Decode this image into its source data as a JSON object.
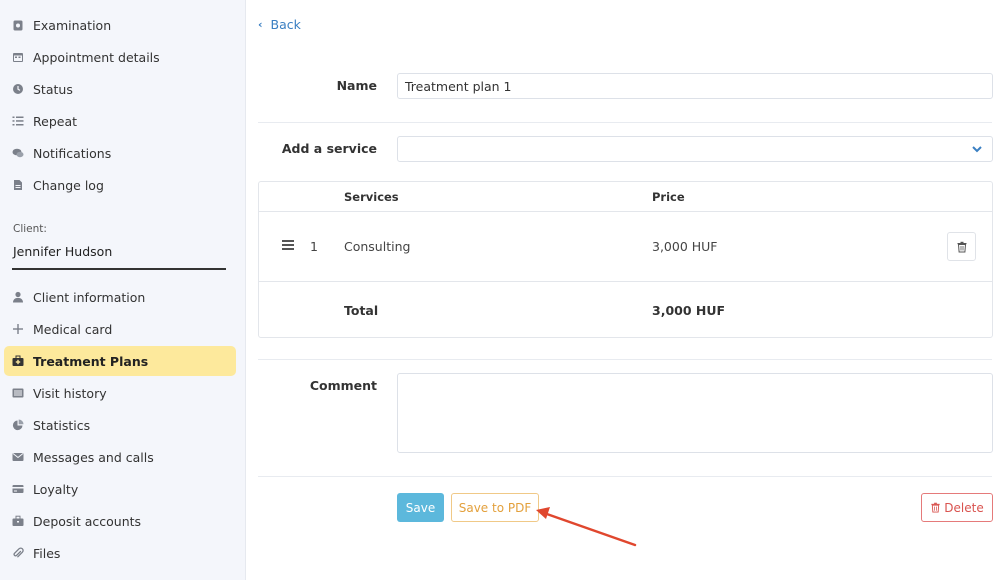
{
  "sidebar": {
    "items_top": [
      {
        "label": "Examination",
        "icon": "stethoscope-icon"
      },
      {
        "label": "Appointment details",
        "icon": "calendar-icon"
      },
      {
        "label": "Status",
        "icon": "clock-icon"
      },
      {
        "label": "Repeat",
        "icon": "list-icon"
      },
      {
        "label": "Notifications",
        "icon": "chat-icon"
      },
      {
        "label": "Change log",
        "icon": "document-icon"
      }
    ],
    "client_label": "Client:",
    "client_name": "Jennifer Hudson",
    "items_bottom": [
      {
        "label": "Client information",
        "icon": "user-icon"
      },
      {
        "label": "Medical card",
        "icon": "plus-icon"
      },
      {
        "label": "Treatment Plans",
        "icon": "medkit-icon",
        "active": true
      },
      {
        "label": "Visit history",
        "icon": "history-list-icon"
      },
      {
        "label": "Statistics",
        "icon": "pie-chart-icon"
      },
      {
        "label": "Messages and calls",
        "icon": "envelope-icon"
      },
      {
        "label": "Loyalty",
        "icon": "credit-card-icon"
      },
      {
        "label": "Deposit accounts",
        "icon": "briefcase-icon"
      },
      {
        "label": "Files",
        "icon": "paperclip-icon"
      }
    ]
  },
  "main": {
    "back_label": "Back",
    "name_label": "Name",
    "name_value": "Treatment plan 1",
    "add_service_label": "Add a service",
    "add_service_value": "",
    "table": {
      "headers": {
        "services": "Services",
        "price": "Price"
      },
      "rows": [
        {
          "index": "1",
          "service": "Consulting",
          "price": "3,000 HUF"
        }
      ],
      "total_label": "Total",
      "total_value": "3,000 HUF"
    },
    "comment_label": "Comment",
    "comment_value": "",
    "buttons": {
      "save": "Save",
      "save_pdf": "Save to PDF",
      "delete": "Delete"
    }
  },
  "colors": {
    "active_nav_bg": "#fde99c",
    "save_button": "#5cb8dc",
    "pdf_button_text": "#e3a03c",
    "delete_button": "#d9534f",
    "link": "#3a7fc2",
    "annotation_arrow": "#e0472e"
  }
}
